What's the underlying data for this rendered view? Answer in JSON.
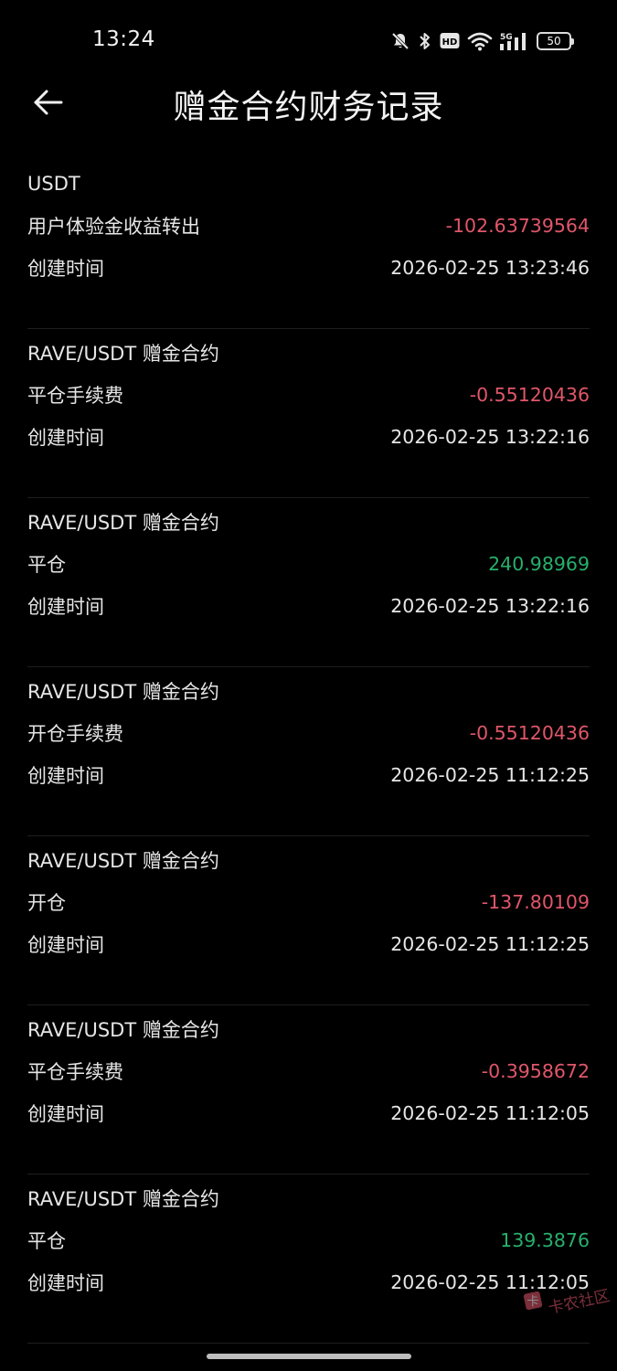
{
  "status_bar": {
    "time": "13:24",
    "network": "5G",
    "battery": "50",
    "hd": "HD",
    "icons": [
      "mute-icon",
      "bluetooth-icon",
      "hd-icon",
      "wifi-icon",
      "signal-icon",
      "battery-icon"
    ]
  },
  "header": {
    "title": "赠金合约财务记录",
    "back_icon": "arrow-left-icon"
  },
  "colors": {
    "negative": "#e0566a",
    "positive": "#27b06c",
    "background": "#000000",
    "text": "#e6e6e6"
  },
  "records": [
    {
      "pair": "USDT",
      "type": "用户体验金收益转出",
      "amount": "-102.63739564",
      "sign": "neg",
      "time_label": "创建时间",
      "time": "2026-02-25 13:23:46"
    },
    {
      "pair": "RAVE/USDT 赠金合约",
      "type": "平仓手续费",
      "amount": "-0.55120436",
      "sign": "neg",
      "time_label": "创建时间",
      "time": "2026-02-25 13:22:16"
    },
    {
      "pair": "RAVE/USDT 赠金合约",
      "type": "平仓",
      "amount": "240.98969",
      "sign": "pos",
      "time_label": "创建时间",
      "time": "2026-02-25 13:22:16"
    },
    {
      "pair": "RAVE/USDT 赠金合约",
      "type": "开仓手续费",
      "amount": "-0.55120436",
      "sign": "neg",
      "time_label": "创建时间",
      "time": "2026-02-25 11:12:25"
    },
    {
      "pair": "RAVE/USDT 赠金合约",
      "type": "开仓",
      "amount": "-137.80109",
      "sign": "neg",
      "time_label": "创建时间",
      "time": "2026-02-25 11:12:25"
    },
    {
      "pair": "RAVE/USDT 赠金合约",
      "type": "平仓手续费",
      "amount": "-0.3958672",
      "sign": "neg",
      "time_label": "创建时间",
      "time": "2026-02-25 11:12:05"
    },
    {
      "pair": "RAVE/USDT 赠金合约",
      "type": "平仓",
      "amount": "139.3876",
      "sign": "pos",
      "time_label": "创建时间",
      "time": "2026-02-25 11:12:05"
    }
  ],
  "watermark": {
    "text": "卡农社区",
    "icon": "kanong-logo-icon"
  }
}
